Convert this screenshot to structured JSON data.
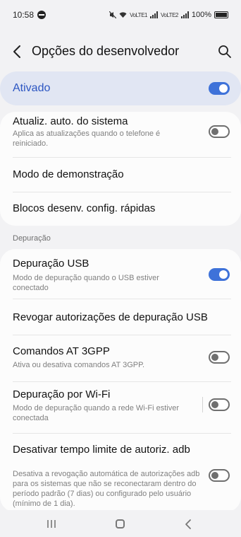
{
  "status_bar": {
    "time": "10:58",
    "network_label_1": "VoLTE1",
    "network_label_2": "VoLTE2",
    "battery": "100%"
  },
  "header": {
    "title": "Opções do desenvolvedor"
  },
  "master_switch": {
    "label": "Ativado",
    "on": true
  },
  "top_section": {
    "items": [
      {
        "title": "Atualiz. auto. do sistema",
        "subtitle": "Aplica as atualizações quando o telefone é reiniciado.",
        "toggle_on": false
      },
      {
        "title": "Modo de demonstração"
      },
      {
        "title": "Blocos desenv. config. rápidas"
      }
    ]
  },
  "debug_section": {
    "header": "Depuração",
    "items": [
      {
        "title": "Depuração USB",
        "subtitle": "Modo de depuração quando o USB estiver conectado",
        "toggle_on": true
      },
      {
        "title": "Revogar autorizações de depuração USB"
      },
      {
        "title": "Comandos AT 3GPP",
        "subtitle": "Ativa ou desativa comandos AT 3GPP.",
        "toggle_on": false
      },
      {
        "title": "Depuração por Wi-Fi",
        "subtitle": "Modo de depuração quando a rede Wi-Fi estiver conectada",
        "toggle_on": false
      },
      {
        "title": "Desativar tempo limite de autoriz. adb",
        "subtitle": "Desativa a revogação automática de autorizações adb para os sistemas que não se reconectaram dentro do período padrão (7 dias) ou configurado pelo usuário (mínimo de 1 dia).",
        "toggle_on": false
      }
    ]
  },
  "icons": {
    "back": "back-arrow-icon",
    "search": "search-icon",
    "nav_recent": "recent-apps-icon",
    "nav_home": "home-icon",
    "nav_back": "nav-back-icon"
  },
  "colors": {
    "accent": "#3e72d9",
    "master_bg": "#e1e6f3",
    "master_text": "#2c56c2"
  }
}
